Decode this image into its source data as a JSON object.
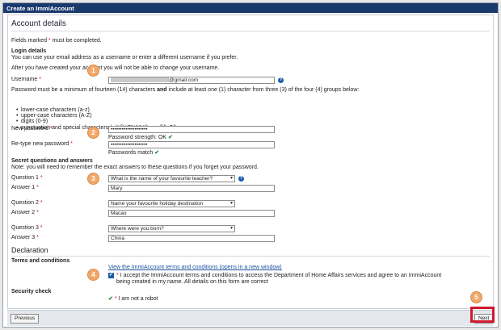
{
  "window": {
    "title": "Create an ImmiAccount"
  },
  "section": {
    "title": "Account details"
  },
  "required_note": {
    "pre": "Fields marked ",
    "star": "*",
    "post": " must be completed."
  },
  "login": {
    "heading": "Login details",
    "desc1": "You can use your email address as a username or enter a different username if you prefer.",
    "desc2": "After you have created your account you will not be able to change your username.",
    "username_label": "Username",
    "username_value": "@gmail.com",
    "pw_rule_a": "Password must be a minimum of fourteen (14) characters ",
    "pw_rule_and": "and",
    "pw_rule_b": " include at least one (1) character from three (3) of the four (4) groups below:",
    "groups": [
      "lower-case characters (a-z)",
      "upper-case characters (A-Z)",
      "digits (0-9)",
      "punctuation and special characters (~`!@#$%^&*()_+=-{}|\\, ?/)"
    ],
    "new_pw_label": "New password",
    "new_pw_value": "••••••••••••••••••••",
    "strength": "Password strength: OK",
    "retype_label": "Re-type new password",
    "retype_value": "••••••••••••••••••••",
    "match": "Passwords match"
  },
  "secret": {
    "heading": "Secret questions and answers",
    "note": "Note: you will need to remember the exact answers to these questions if you forget your password.",
    "q1_label": "Question 1",
    "q1_value": "What is the name of your favourite teacher?",
    "a1_label": "Answer 1",
    "a1_value": "Mary",
    "q2_label": "Question 2",
    "q2_value": "Name your favourite holiday destination",
    "a2_label": "Answer 2",
    "a2_value": "Macao",
    "q3_label": "Question 3",
    "q3_value": "Where were you born?",
    "a3_label": "Answer 3",
    "a3_value": "China"
  },
  "declaration": {
    "heading": "Declaration",
    "terms_heading": "Terms and conditions",
    "terms_link": "View the ImmiAccount terms and conditions (opens in a new window)",
    "accept_line1": "I accept the ImmiAccount terms and conditions to access the Department of Home Affairs services and agree to an ImmiAccount",
    "accept_line2": "being created in my name. All details on this form are correct",
    "security_heading": "Security check",
    "robot": "I am not a robot"
  },
  "steps": [
    "1",
    "2",
    "3",
    "4",
    "5"
  ],
  "footer": {
    "previous": "Previous",
    "next": "Next"
  },
  "symbols": {
    "star": "*",
    "help": "?",
    "tick": "✔",
    "arrow": "▾"
  },
  "colors": {
    "titlebar": "#1a3a6e",
    "step_badge": "#f2a86a",
    "highlight": "#d0192f",
    "ok": "#2e8b3d"
  }
}
